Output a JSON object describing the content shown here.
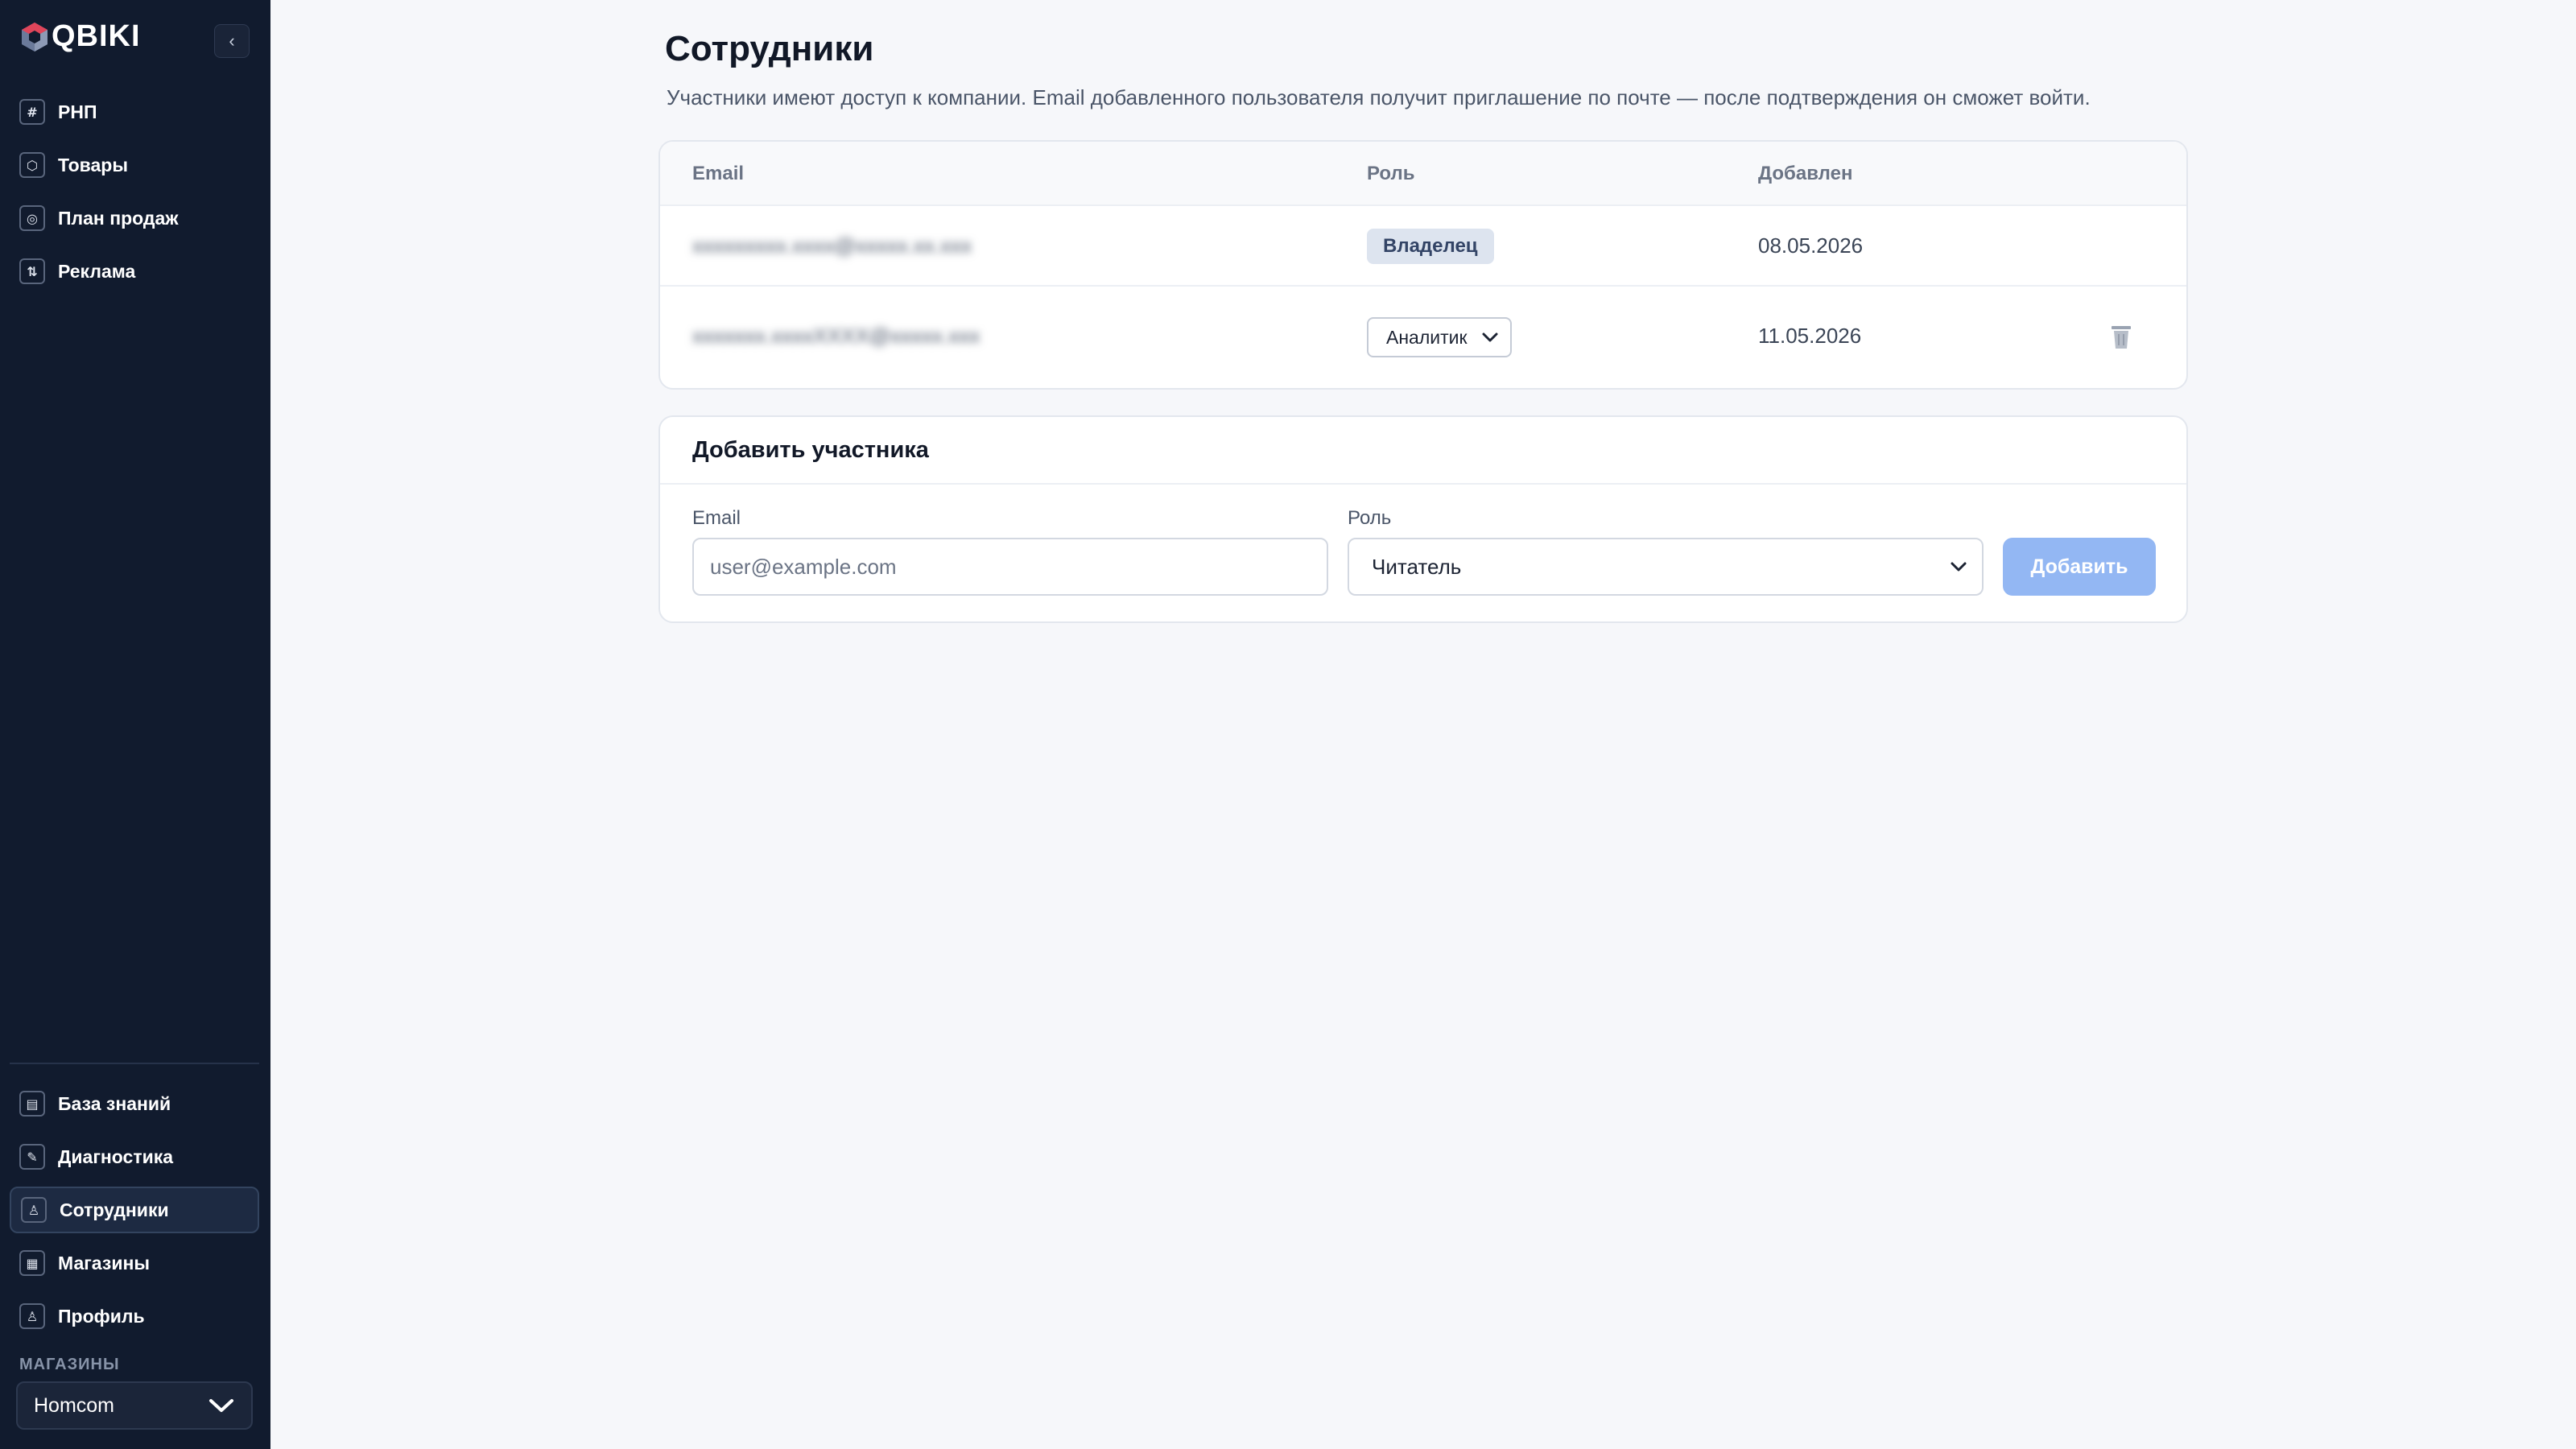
{
  "brand": {
    "name": "QBIKI"
  },
  "sidebar": {
    "collapse_label": "‹",
    "top_items": [
      {
        "label": "РНП",
        "icon": "grid-icon",
        "glyph": "#"
      },
      {
        "label": "Товары",
        "icon": "box-icon",
        "glyph": "⬡"
      },
      {
        "label": "План продаж",
        "icon": "target-icon",
        "glyph": "◎"
      },
      {
        "label": "Реклама",
        "icon": "sort-icon",
        "glyph": "⇅"
      }
    ],
    "bottom_items": [
      {
        "label": "База знаний",
        "icon": "book-icon",
        "glyph": "▤"
      },
      {
        "label": "Диагностика",
        "icon": "wrench-icon",
        "glyph": "✎"
      },
      {
        "label": "Сотрудники",
        "icon": "users-icon",
        "glyph": "♙",
        "active": true
      },
      {
        "label": "Магазины",
        "icon": "store-icon",
        "glyph": "▦"
      },
      {
        "label": "Профиль",
        "icon": "user-icon",
        "glyph": "♙"
      }
    ],
    "stores_caption": "МАГАЗИНЫ",
    "store_selected": "Homcom"
  },
  "page": {
    "title": "Сотрудники",
    "subtitle": "Участники имеют доступ к компании. Email добавленного пользователя получит приглашение по почте — после подтверждения он сможет войти."
  },
  "members_table": {
    "columns": [
      "Email",
      "Роль",
      "Добавлен"
    ],
    "rows": [
      {
        "email": "xxxxxxxxx.xxxx@xxxxx.xx.xxx",
        "role": "Владелец",
        "added": "08.05.2026"
      },
      {
        "email": "xxxxxxx.xxxxXXXX@xxxxx.xxx",
        "role": "Аналитик",
        "added": "11.05.2026"
      }
    ]
  },
  "add_member": {
    "title": "Добавить участника",
    "email_label": "Email",
    "email_placeholder": "user@example.com",
    "role_label": "Роль",
    "role_selected": "Читатель",
    "submit_label": "Добавить"
  },
  "colors": {
    "sidebar_bg": "#111b2e",
    "accent_disabled": "#93b7f3",
    "page_bg": "#f6f7fa"
  }
}
